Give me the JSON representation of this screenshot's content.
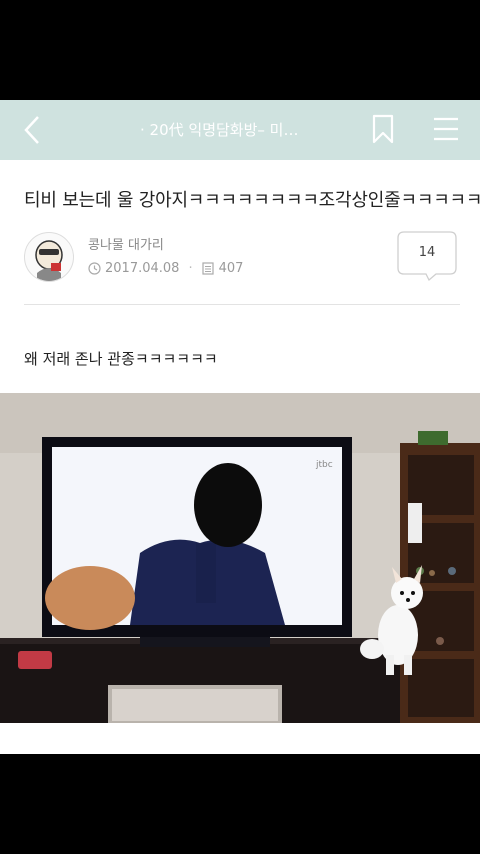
{
  "header": {
    "title": "· 20代 익명담화방– 미…",
    "back_icon": "chevron-left-icon",
    "bookmark_icon": "bookmark-icon",
    "menu_icon": "hamburger-menu-icon",
    "background": "#cfe2df"
  },
  "post": {
    "title": "티비 보는데 울 강아지ㅋㅋㅋㅋㅋㅋㅋㅋ조각상인줄ㅋㅋㅋㅋㅋ",
    "author": "콩나물 대가리",
    "date": "2017.04.08",
    "views": "407",
    "comment_count": "14",
    "body": "왜 저래 존나 관종ㅋㅋㅋㅋㅋㅋ"
  },
  "photo": {
    "tv_logo": "jtbc"
  }
}
